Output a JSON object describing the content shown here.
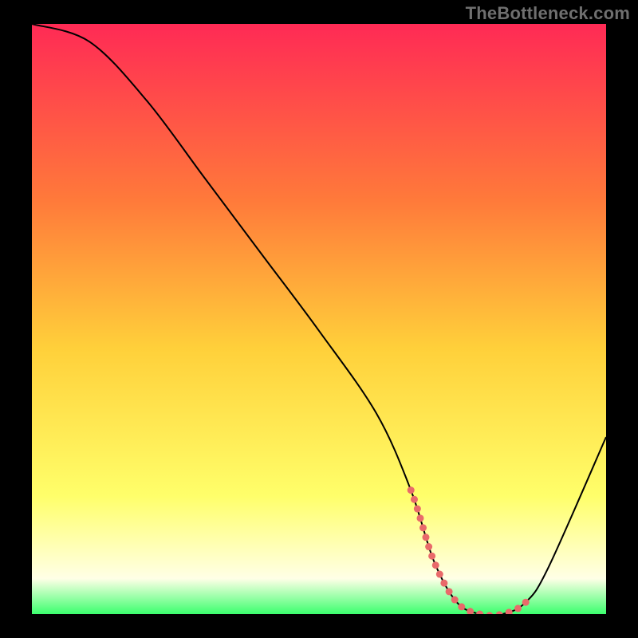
{
  "watermark": "TheBottleneck.com",
  "chart_data": {
    "type": "line",
    "title": "",
    "xlabel": "",
    "ylabel": "",
    "xlim": [
      0,
      100
    ],
    "ylim": [
      0,
      100
    ],
    "x": [
      0,
      10,
      20,
      30,
      40,
      50,
      60,
      66,
      70,
      74,
      78,
      82,
      86,
      90,
      100
    ],
    "values": [
      100,
      97,
      87,
      74,
      61,
      48,
      34,
      21,
      9,
      2,
      0,
      0,
      2,
      8,
      30
    ],
    "flat_zone": {
      "start_x": 66,
      "end_x": 86,
      "max_y": 4
    },
    "gradient_colors": {
      "top": "#ff2a55",
      "upper_mid": "#ff7a3a",
      "mid": "#ffd03a",
      "lower_mid": "#ffff6a",
      "bottom_band_top": "#ffffe6",
      "bottom_band_bottom": "#3cff6e"
    },
    "series_color": "#000000",
    "dot_color": "#e96a6a"
  }
}
